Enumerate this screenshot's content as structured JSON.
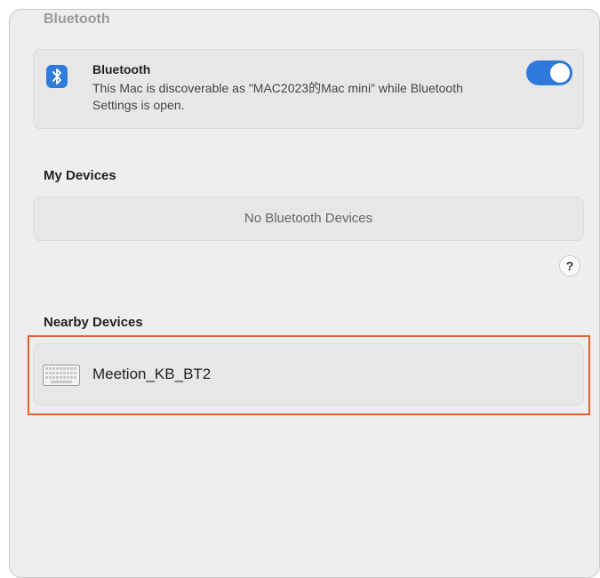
{
  "header": {
    "section_title": "Bluetooth"
  },
  "bluetooth": {
    "title": "Bluetooth",
    "description": "This Mac is discoverable as \"MAC2023的Mac mini\" while Bluetooth Settings is open.",
    "enabled": true,
    "icon": "bluetooth-icon",
    "toggle_color": "#2e79d9"
  },
  "my_devices": {
    "title": "My Devices",
    "empty_text": "No Bluetooth Devices"
  },
  "help": {
    "label": "?"
  },
  "nearby_devices": {
    "title": "Nearby Devices",
    "items": [
      {
        "name": "Meetion_KB_BT2",
        "icon": "keyboard-icon"
      }
    ],
    "highlight_color": "#e2612d"
  }
}
